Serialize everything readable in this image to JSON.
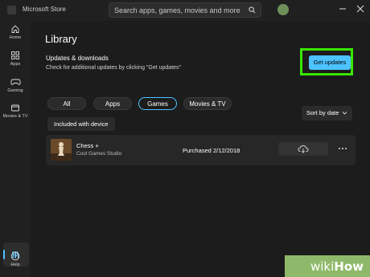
{
  "titlebar": {
    "app_title": "Microsoft Store",
    "search_placeholder": "Search apps, games, movies and more",
    "app_icon": "store-icon",
    "search_icon": "search-icon",
    "minimize_icon": "minimize-icon",
    "close_icon": "close-icon"
  },
  "sidebar": {
    "items": [
      {
        "label": "Home",
        "icon": "home-icon"
      },
      {
        "label": "Apps",
        "icon": "apps-icon"
      },
      {
        "label": "Gaming",
        "icon": "gaming-icon"
      },
      {
        "label": "Movies & TV",
        "icon": "movies-icon"
      }
    ],
    "library_icon": "library-icon",
    "help": {
      "label": "Help",
      "icon": "help-icon"
    }
  },
  "main": {
    "title": "Library",
    "updates": {
      "title": "Updates & downloads",
      "description": "Check for additional updates by clicking \"Get updates\"",
      "button_label": "Get updates"
    },
    "filters": [
      {
        "label": "All",
        "active": false
      },
      {
        "label": "Apps",
        "active": false
      },
      {
        "label": "Games",
        "active": true
      },
      {
        "label": "Movies & TV",
        "active": false
      }
    ],
    "sort_label": "Sort by date",
    "included_label": "Included with device",
    "items": [
      {
        "name": "Chess +",
        "developer": "Cool Games Studio",
        "purchased": "Purchased 2/12/2018"
      }
    ]
  },
  "watermark": {
    "wiki": "wiki",
    "how": "How"
  },
  "colors": {
    "accent": "#4cc2ff",
    "highlight": "#39e600",
    "background": "#1c1c1c",
    "watermark": "#8fb96a"
  }
}
